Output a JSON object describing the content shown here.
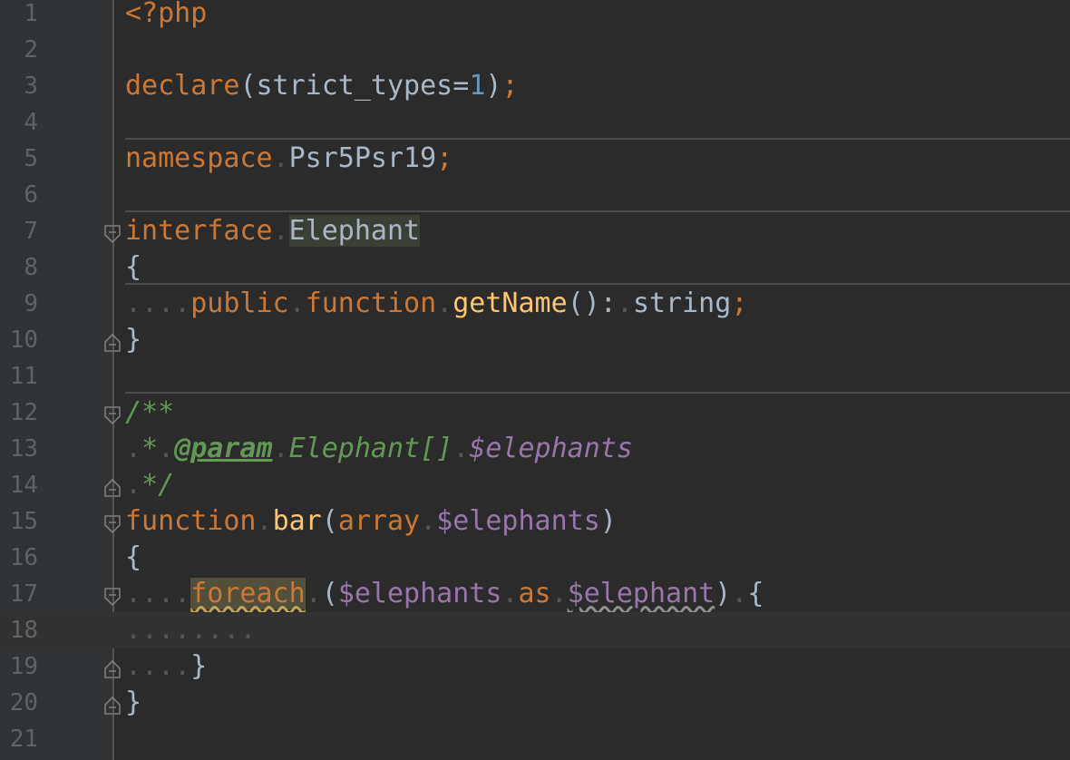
{
  "editor": {
    "language": "php",
    "current_line": 18,
    "line_numbers": [
      "1",
      "2",
      "3",
      "4",
      "5",
      "6",
      "7",
      "8",
      "9",
      "10",
      "11",
      "12",
      "13",
      "14",
      "15",
      "16",
      "17",
      "18",
      "19",
      "20",
      "21"
    ],
    "lines": {
      "l1": {
        "t1": "<?php"
      },
      "l3": {
        "t1": "declare",
        "t2": "(strict_types=",
        "t3": "1",
        "t4": ")",
        "t5": ";"
      },
      "l5": {
        "t1": "namespace",
        "t2": ".",
        "t3": "Psr5Psr19",
        "t4": ";"
      },
      "l7": {
        "t1": "interface",
        "t2": ".",
        "t3": "Elephant"
      },
      "l8": {
        "t1": "{"
      },
      "l9": {
        "t1": "....",
        "t2": "public",
        "t3": ".",
        "t4": "function",
        "t5": ".",
        "t6": "getName",
        "t7": "():",
        "t8": ".",
        "t9": "string",
        "t10": ";"
      },
      "l10": {
        "t1": "}"
      },
      "l12": {
        "t1": "/**"
      },
      "l13": {
        "t1": ".",
        "t2": "*",
        "t3": ".",
        "t4": "@param",
        "t5": ".",
        "t6": "Elephant[]",
        "t7": ".",
        "t8": "$elephants"
      },
      "l14": {
        "t1": ".",
        "t2": "*/"
      },
      "l15": {
        "t1": "function",
        "t2": ".",
        "t3": "bar",
        "t4": "(",
        "t5": "array",
        "t6": ".",
        "t7": "$elephants",
        "t8": ")"
      },
      "l16": {
        "t1": "{"
      },
      "l17": {
        "t1": "....",
        "t2": "foreach",
        "t3": ".",
        "t4": "(",
        "t5": "$elephants",
        "t6": ".",
        "t7": "as",
        "t8": ".",
        "t9": "$elephant",
        "t10": ")",
        "t11": ".",
        "t12": "{"
      },
      "l18": {
        "t1": "........"
      },
      "l19": {
        "t1": "....",
        "t2": "}"
      },
      "l20": {
        "t1": "}"
      }
    }
  },
  "colors": {
    "background": "#2b2b2b",
    "gutter": "#313335",
    "keyword": "#cc7832",
    "function": "#ffc66d",
    "number": "#6897bb",
    "variable": "#9876aa",
    "doc_comment": "#629755",
    "text": "#a9b7c6"
  }
}
